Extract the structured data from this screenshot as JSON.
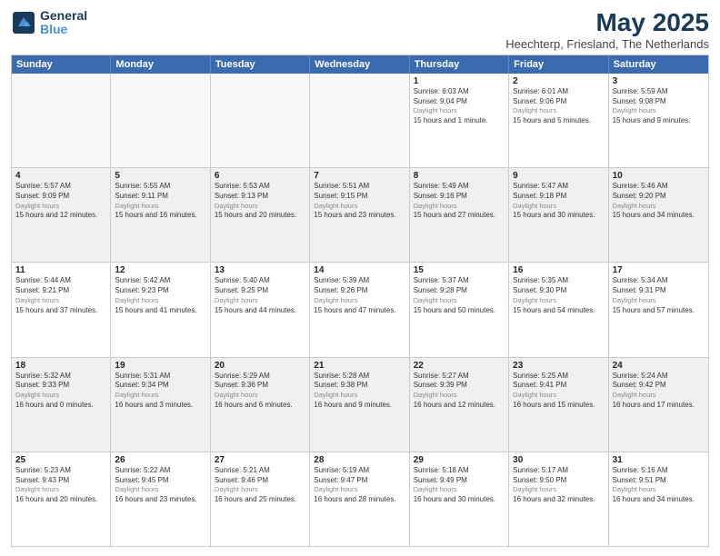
{
  "logo": {
    "general": "General",
    "blue": "Blue"
  },
  "title": "May 2025",
  "location": "Heechterp, Friesland, The Netherlands",
  "days": [
    "Sunday",
    "Monday",
    "Tuesday",
    "Wednesday",
    "Thursday",
    "Friday",
    "Saturday"
  ],
  "rows": [
    [
      {
        "day": "",
        "data": ""
      },
      {
        "day": "",
        "data": ""
      },
      {
        "day": "",
        "data": ""
      },
      {
        "day": "",
        "data": ""
      },
      {
        "day": "1",
        "sunrise": "Sunrise: 6:03 AM",
        "sunset": "Sunset: 9:04 PM",
        "daylight": "Daylight: 15 hours and 1 minute."
      },
      {
        "day": "2",
        "sunrise": "Sunrise: 6:01 AM",
        "sunset": "Sunset: 9:06 PM",
        "daylight": "Daylight: 15 hours and 5 minutes."
      },
      {
        "day": "3",
        "sunrise": "Sunrise: 5:59 AM",
        "sunset": "Sunset: 9:08 PM",
        "daylight": "Daylight: 15 hours and 9 minutes."
      }
    ],
    [
      {
        "day": "4",
        "sunrise": "Sunrise: 5:57 AM",
        "sunset": "Sunset: 9:09 PM",
        "daylight": "Daylight: 15 hours and 12 minutes."
      },
      {
        "day": "5",
        "sunrise": "Sunrise: 5:55 AM",
        "sunset": "Sunset: 9:11 PM",
        "daylight": "Daylight: 15 hours and 16 minutes."
      },
      {
        "day": "6",
        "sunrise": "Sunrise: 5:53 AM",
        "sunset": "Sunset: 9:13 PM",
        "daylight": "Daylight: 15 hours and 20 minutes."
      },
      {
        "day": "7",
        "sunrise": "Sunrise: 5:51 AM",
        "sunset": "Sunset: 9:15 PM",
        "daylight": "Daylight: 15 hours and 23 minutes."
      },
      {
        "day": "8",
        "sunrise": "Sunrise: 5:49 AM",
        "sunset": "Sunset: 9:16 PM",
        "daylight": "Daylight: 15 hours and 27 minutes."
      },
      {
        "day": "9",
        "sunrise": "Sunrise: 5:47 AM",
        "sunset": "Sunset: 9:18 PM",
        "daylight": "Daylight: 15 hours and 30 minutes."
      },
      {
        "day": "10",
        "sunrise": "Sunrise: 5:46 AM",
        "sunset": "Sunset: 9:20 PM",
        "daylight": "Daylight: 15 hours and 34 minutes."
      }
    ],
    [
      {
        "day": "11",
        "sunrise": "Sunrise: 5:44 AM",
        "sunset": "Sunset: 9:21 PM",
        "daylight": "Daylight: 15 hours and 37 minutes."
      },
      {
        "day": "12",
        "sunrise": "Sunrise: 5:42 AM",
        "sunset": "Sunset: 9:23 PM",
        "daylight": "Daylight: 15 hours and 41 minutes."
      },
      {
        "day": "13",
        "sunrise": "Sunrise: 5:40 AM",
        "sunset": "Sunset: 9:25 PM",
        "daylight": "Daylight: 15 hours and 44 minutes."
      },
      {
        "day": "14",
        "sunrise": "Sunrise: 5:39 AM",
        "sunset": "Sunset: 9:26 PM",
        "daylight": "Daylight: 15 hours and 47 minutes."
      },
      {
        "day": "15",
        "sunrise": "Sunrise: 5:37 AM",
        "sunset": "Sunset: 9:28 PM",
        "daylight": "Daylight: 15 hours and 50 minutes."
      },
      {
        "day": "16",
        "sunrise": "Sunrise: 5:35 AM",
        "sunset": "Sunset: 9:30 PM",
        "daylight": "Daylight: 15 hours and 54 minutes."
      },
      {
        "day": "17",
        "sunrise": "Sunrise: 5:34 AM",
        "sunset": "Sunset: 9:31 PM",
        "daylight": "Daylight: 15 hours and 57 minutes."
      }
    ],
    [
      {
        "day": "18",
        "sunrise": "Sunrise: 5:32 AM",
        "sunset": "Sunset: 9:33 PM",
        "daylight": "Daylight: 16 hours and 0 minutes."
      },
      {
        "day": "19",
        "sunrise": "Sunrise: 5:31 AM",
        "sunset": "Sunset: 9:34 PM",
        "daylight": "Daylight: 16 hours and 3 minutes."
      },
      {
        "day": "20",
        "sunrise": "Sunrise: 5:29 AM",
        "sunset": "Sunset: 9:36 PM",
        "daylight": "Daylight: 16 hours and 6 minutes."
      },
      {
        "day": "21",
        "sunrise": "Sunrise: 5:28 AM",
        "sunset": "Sunset: 9:38 PM",
        "daylight": "Daylight: 16 hours and 9 minutes."
      },
      {
        "day": "22",
        "sunrise": "Sunrise: 5:27 AM",
        "sunset": "Sunset: 9:39 PM",
        "daylight": "Daylight: 16 hours and 12 minutes."
      },
      {
        "day": "23",
        "sunrise": "Sunrise: 5:25 AM",
        "sunset": "Sunset: 9:41 PM",
        "daylight": "Daylight: 16 hours and 15 minutes."
      },
      {
        "day": "24",
        "sunrise": "Sunrise: 5:24 AM",
        "sunset": "Sunset: 9:42 PM",
        "daylight": "Daylight: 16 hours and 17 minutes."
      }
    ],
    [
      {
        "day": "25",
        "sunrise": "Sunrise: 5:23 AM",
        "sunset": "Sunset: 9:43 PM",
        "daylight": "Daylight: 16 hours and 20 minutes."
      },
      {
        "day": "26",
        "sunrise": "Sunrise: 5:22 AM",
        "sunset": "Sunset: 9:45 PM",
        "daylight": "Daylight: 16 hours and 23 minutes."
      },
      {
        "day": "27",
        "sunrise": "Sunrise: 5:21 AM",
        "sunset": "Sunset: 9:46 PM",
        "daylight": "Daylight: 16 hours and 25 minutes."
      },
      {
        "day": "28",
        "sunrise": "Sunrise: 5:19 AM",
        "sunset": "Sunset: 9:47 PM",
        "daylight": "Daylight: 16 hours and 28 minutes."
      },
      {
        "day": "29",
        "sunrise": "Sunrise: 5:18 AM",
        "sunset": "Sunset: 9:49 PM",
        "daylight": "Daylight: 16 hours and 30 minutes."
      },
      {
        "day": "30",
        "sunrise": "Sunrise: 5:17 AM",
        "sunset": "Sunset: 9:50 PM",
        "daylight": "Daylight: 16 hours and 32 minutes."
      },
      {
        "day": "31",
        "sunrise": "Sunrise: 5:16 AM",
        "sunset": "Sunset: 9:51 PM",
        "daylight": "Daylight: 16 hours and 34 minutes."
      }
    ]
  ]
}
